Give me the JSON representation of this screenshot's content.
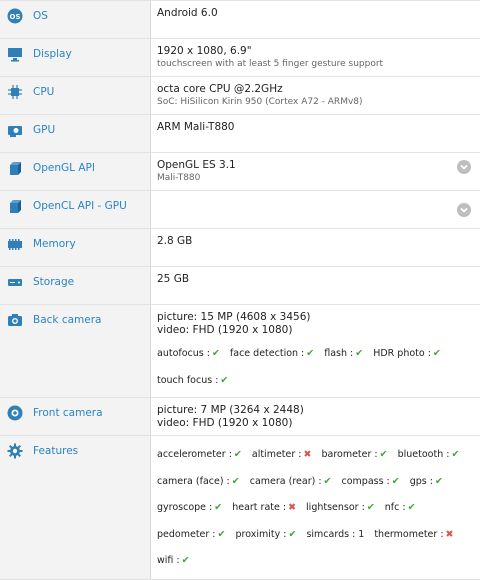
{
  "rows": {
    "os": {
      "label": "OS",
      "line1": "Android 6.0"
    },
    "display": {
      "label": "Display",
      "line1": "1920 x 1080, 6.9\"",
      "line2": "touchscreen with at least 5 finger gesture support"
    },
    "cpu": {
      "label": "CPU",
      "line1": "octa core CPU @2.2GHz",
      "line2": "SoC: HiSilicon Kirin 950 (Cortex A72 - ARMv8)"
    },
    "gpu": {
      "label": "GPU",
      "line1": "ARM Mali-T880"
    },
    "opengl": {
      "label": "OpenGL API",
      "line1": "OpenGL ES 3.1",
      "line2": "Mali-T880"
    },
    "opencl": {
      "label": "OpenCL API - GPU"
    },
    "memory": {
      "label": "Memory",
      "line1": "2.8 GB"
    },
    "storage": {
      "label": "Storage",
      "line1": "25 GB"
    },
    "back_camera": {
      "label": "Back camera",
      "line1": "picture: 15 MP (4608 x 3456)",
      "line2": "video: FHD (1920 x 1080)",
      "features": [
        {
          "name": "autofocus :",
          "status": "yes"
        },
        {
          "name": "face detection :",
          "status": "yes"
        },
        {
          "name": "flash :",
          "status": "yes"
        },
        {
          "name": "HDR photo :",
          "status": "yes"
        },
        {
          "name": "touch focus :",
          "status": "yes"
        }
      ]
    },
    "front_camera": {
      "label": "Front camera",
      "line1": "picture: 7 MP (3264 x 2448)",
      "line2": "video: FHD (1920 x 1080)"
    },
    "features": {
      "label": "Features",
      "items": [
        {
          "name": "accelerometer :",
          "status": "yes"
        },
        {
          "name": "altimeter :",
          "status": "no"
        },
        {
          "name": "barometer :",
          "status": "yes"
        },
        {
          "name": "bluetooth :",
          "status": "yes"
        },
        {
          "name": "camera (face) :",
          "status": "yes"
        },
        {
          "name": "camera (rear) :",
          "status": "yes"
        },
        {
          "name": "compass :",
          "status": "yes"
        },
        {
          "name": "gps :",
          "status": "yes"
        },
        {
          "name": "gyroscope :",
          "status": "yes"
        },
        {
          "name": "heart rate :",
          "status": "no"
        },
        {
          "name": "lightsensor :",
          "status": "yes"
        },
        {
          "name": "nfc :",
          "status": "yes"
        },
        {
          "name": "pedometer :",
          "status": "yes"
        },
        {
          "name": "proximity :",
          "status": "yes"
        },
        {
          "name": "simcards : 1",
          "status": "none"
        },
        {
          "name": "thermometer :",
          "status": "no"
        },
        {
          "name": "wifi :",
          "status": "yes"
        }
      ]
    }
  },
  "symbols": {
    "yes": "✔",
    "no": "✖"
  },
  "colors": {
    "label": "#2a84c2",
    "icon": "#2f7fb8",
    "yes": "#3aa33a",
    "no": "#d9534f"
  }
}
